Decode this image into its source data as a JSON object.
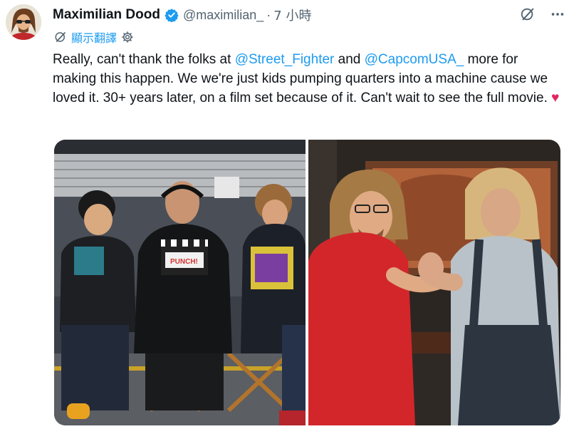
{
  "tweet": {
    "display_name": "Maximilian Dood",
    "handle": "@maximilian_",
    "separator": "·",
    "time": "7 小時",
    "translate_label": "顯示翻譯",
    "text": {
      "part1": "Really, can't thank the folks at ",
      "mention1": "@Street_Fighter",
      "part2": " and ",
      "mention2": "@CapcomUSA_",
      "part3": " more for making this happen. We we're just kids pumping quarters into a machine cause we loved it. 30+ years later, on a film set because of it. Can't wait to see the full movie. ",
      "emoji": "♥"
    },
    "clapperboard_text": "PUNCH!",
    "accent_color": "#1d9bf0",
    "verified_color": "#1d9bf0",
    "heart_color": "#e0245e"
  },
  "icons": {
    "grok": "grok-icon",
    "more": "more-icon",
    "translate": "translate-icon",
    "settings": "gear-icon",
    "verified": "verified-badge-icon"
  }
}
